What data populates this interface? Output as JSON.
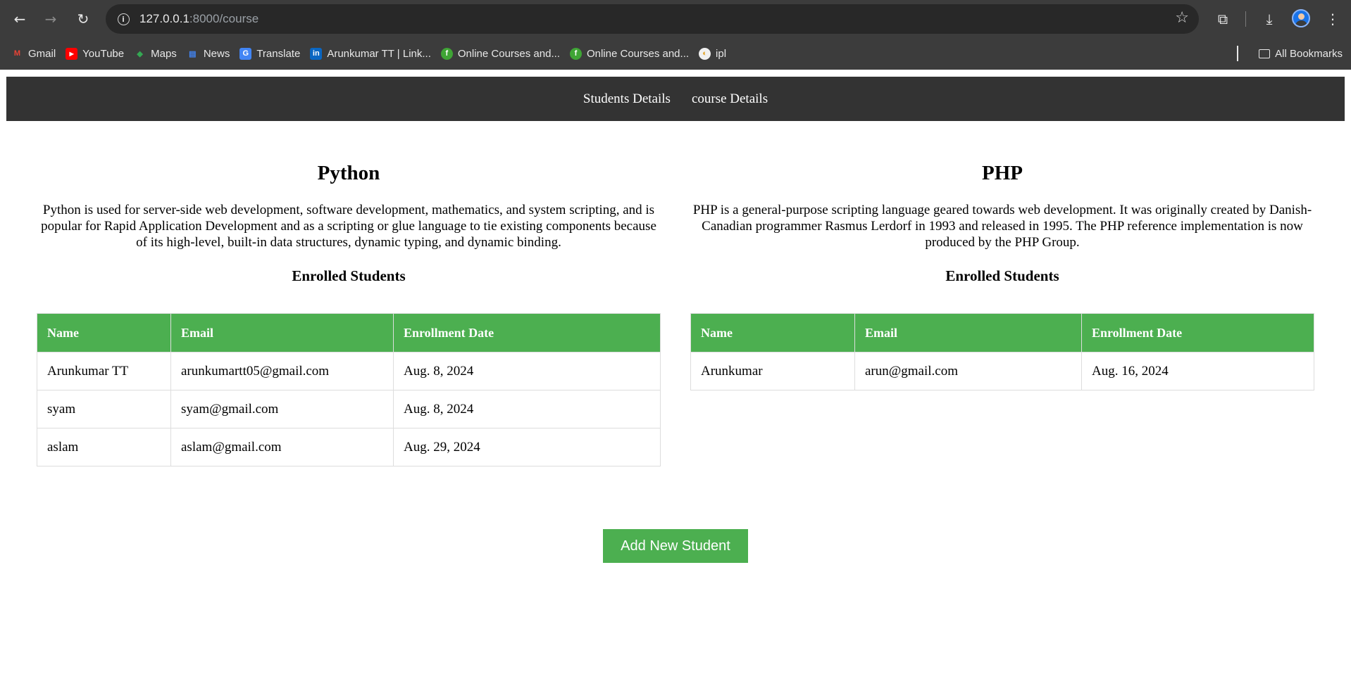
{
  "browser": {
    "url_host": "127.0.0.1",
    "url_rest": ":8000/course",
    "bookmarks": [
      {
        "label": "Gmail",
        "icon": "gmail-icon",
        "glyph": "M",
        "color": "#ea4335"
      },
      {
        "label": "YouTube",
        "icon": "youtube-icon",
        "glyph": "▶",
        "color": "#ff0000"
      },
      {
        "label": "Maps",
        "icon": "maps-icon",
        "glyph": "◆",
        "color": "#34a853"
      },
      {
        "label": "News",
        "icon": "news-icon",
        "glyph": "▤",
        "color": "#4285f4"
      },
      {
        "label": "Translate",
        "icon": "translate-icon",
        "glyph": "G",
        "color": "#4285f4"
      },
      {
        "label": "Arunkumar TT | Link...",
        "icon": "linkedin-icon",
        "glyph": "in",
        "color": "#0a66c2"
      },
      {
        "label": "Online Courses and...",
        "icon": "courses-icon",
        "glyph": "f",
        "color": "#3fa535"
      },
      {
        "label": "Online Courses and...",
        "icon": "courses-icon",
        "glyph": "f",
        "color": "#3fa535"
      },
      {
        "label": "ipl",
        "icon": "ipl-icon",
        "glyph": "◐",
        "color": "#f0f0f0"
      }
    ],
    "all_bookmarks": "All Bookmarks"
  },
  "nav": {
    "students_link": "Students Details",
    "course_link": "course Details"
  },
  "courses": [
    {
      "title": "Python",
      "description": "Python is used for server-side web development, software development, mathematics, and system scripting, and is popular for Rapid Application Development and as a scripting or glue language to tie existing components because of its high-level, built-in data structures, dynamic typing, and dynamic binding.",
      "enrolled_heading": "Enrolled Students",
      "columns": [
        "Name",
        "Email",
        "Enrollment Date"
      ],
      "rows": [
        [
          "Arunkumar TT",
          "arunkumartt05@gmail.com",
          "Aug. 8, 2024"
        ],
        [
          "syam",
          "syam@gmail.com",
          "Aug. 8, 2024"
        ],
        [
          "aslam",
          "aslam@gmail.com",
          "Aug. 29, 2024"
        ]
      ]
    },
    {
      "title": "PHP",
      "description": "PHP is a general-purpose scripting language geared towards web development. It was originally created by Danish-Canadian programmer Rasmus Lerdorf in 1993 and released in 1995. The PHP reference implementation is now produced by the PHP Group.",
      "enrolled_heading": "Enrolled Students",
      "columns": [
        "Name",
        "Email",
        "Enrollment Date"
      ],
      "rows": [
        [
          "Arunkumar",
          "arun@gmail.com",
          "Aug. 16, 2024"
        ]
      ]
    }
  ],
  "add_button": "Add New Student",
  "colors": {
    "accent": "#4caf50",
    "navbar": "#333333",
    "chrome": "#3c3c3c"
  }
}
